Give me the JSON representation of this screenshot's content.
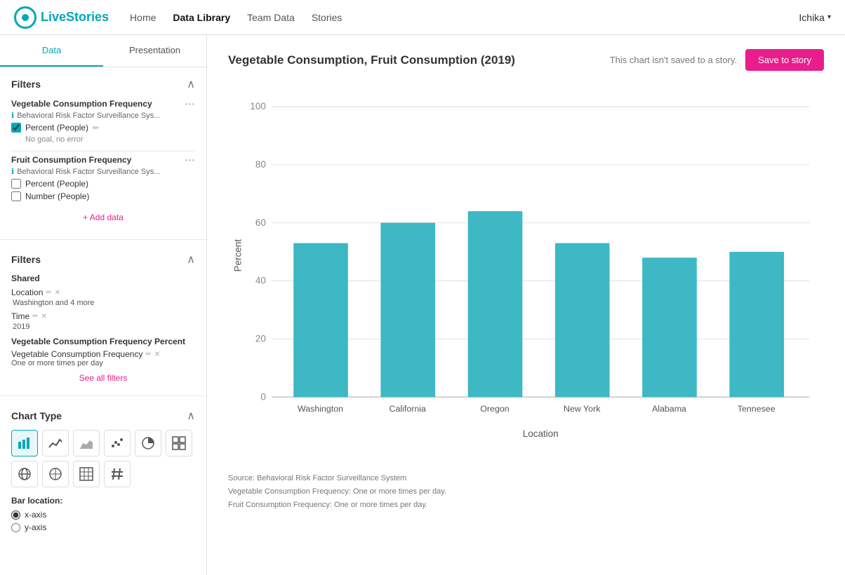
{
  "nav": {
    "logo_text": "LiveStories",
    "links": [
      "Home",
      "Data Library",
      "Team Data",
      "Stories"
    ],
    "active_link": "Data Library",
    "user": "Ichika"
  },
  "sidebar": {
    "tab_data": "Data",
    "tab_presentation": "Presentation",
    "active_tab": "Data",
    "filters_section": {
      "title": "Filters",
      "veg_filter": {
        "name": "Vegetable Consumption Frequency",
        "source": "Behavioral Risk Factor Surveillance Sys...",
        "metric": "Percent (People)",
        "hint": "No goal, no error",
        "checked": true
      },
      "fruit_filter": {
        "name": "Fruit Consumption Frequency",
        "source": "Behavioral Risk Factor Surveillance Sys...",
        "metrics": [
          {
            "label": "Percent (People)",
            "checked": false
          },
          {
            "label": "Number (People)",
            "checked": false
          }
        ]
      },
      "add_data_label": "+ Add data"
    },
    "shared_filters": {
      "title": "Filters",
      "shared_label": "Shared",
      "location_label": "Location",
      "location_value": "Washington and 4 more",
      "time_label": "Time",
      "time_value": "2019",
      "veg_freq_title": "Vegetable Consumption Frequency Percent",
      "veg_freq_label": "Vegetable Consumption Frequency",
      "veg_freq_value": "One or more times per day",
      "see_all": "See all filters"
    },
    "chart_type": {
      "title": "Chart Type",
      "icons": [
        {
          "name": "bar-chart-icon",
          "symbol": "▐█",
          "active": true
        },
        {
          "name": "line-chart-icon",
          "symbol": "〰",
          "active": false
        },
        {
          "name": "area-chart-icon",
          "symbol": "◿◣",
          "active": false
        },
        {
          "name": "scatter-chart-icon",
          "symbol": "⁘",
          "active": false
        },
        {
          "name": "pie-chart-icon",
          "symbol": "◔",
          "active": false
        },
        {
          "name": "grid-chart-icon",
          "symbol": "▦",
          "active": false
        },
        {
          "name": "map-icon",
          "symbol": "⬡",
          "active": false
        },
        {
          "name": "globe-icon",
          "symbol": "⊕",
          "active": false
        },
        {
          "name": "table-icon",
          "symbol": "⊞",
          "active": false
        },
        {
          "name": "hash-icon",
          "symbol": "#",
          "active": false
        }
      ],
      "bar_location_label": "Bar location:",
      "bar_options": [
        {
          "value": "x-axis",
          "label": "x-axis",
          "checked": true
        },
        {
          "value": "y-axis",
          "label": "y-axis",
          "checked": false
        }
      ]
    }
  },
  "chart": {
    "title": "Vegetable Consumption, Fruit Consumption (2019)",
    "status_text": "This chart isn't saved to a story.",
    "save_button": "Save to story",
    "y_label": "Percent",
    "x_label": "Location",
    "y_ticks": [
      0,
      20,
      40,
      60,
      80,
      100
    ],
    "bars": [
      {
        "location": "Washington",
        "value": 53
      },
      {
        "location": "California",
        "value": 60
      },
      {
        "location": "Oregon",
        "value": 64
      },
      {
        "location": "New York",
        "value": 53
      },
      {
        "location": "Alabama",
        "value": 48
      },
      {
        "location": "Tennesee",
        "value": 50
      }
    ],
    "source_lines": [
      "Source: Behavioral Risk Factor Surveillance System",
      "Vegetable Consumption Frequency: One or more times per day.",
      "Fruit Consumption Frequency: One or more times per day."
    ],
    "bar_color": "#3db8c4"
  }
}
